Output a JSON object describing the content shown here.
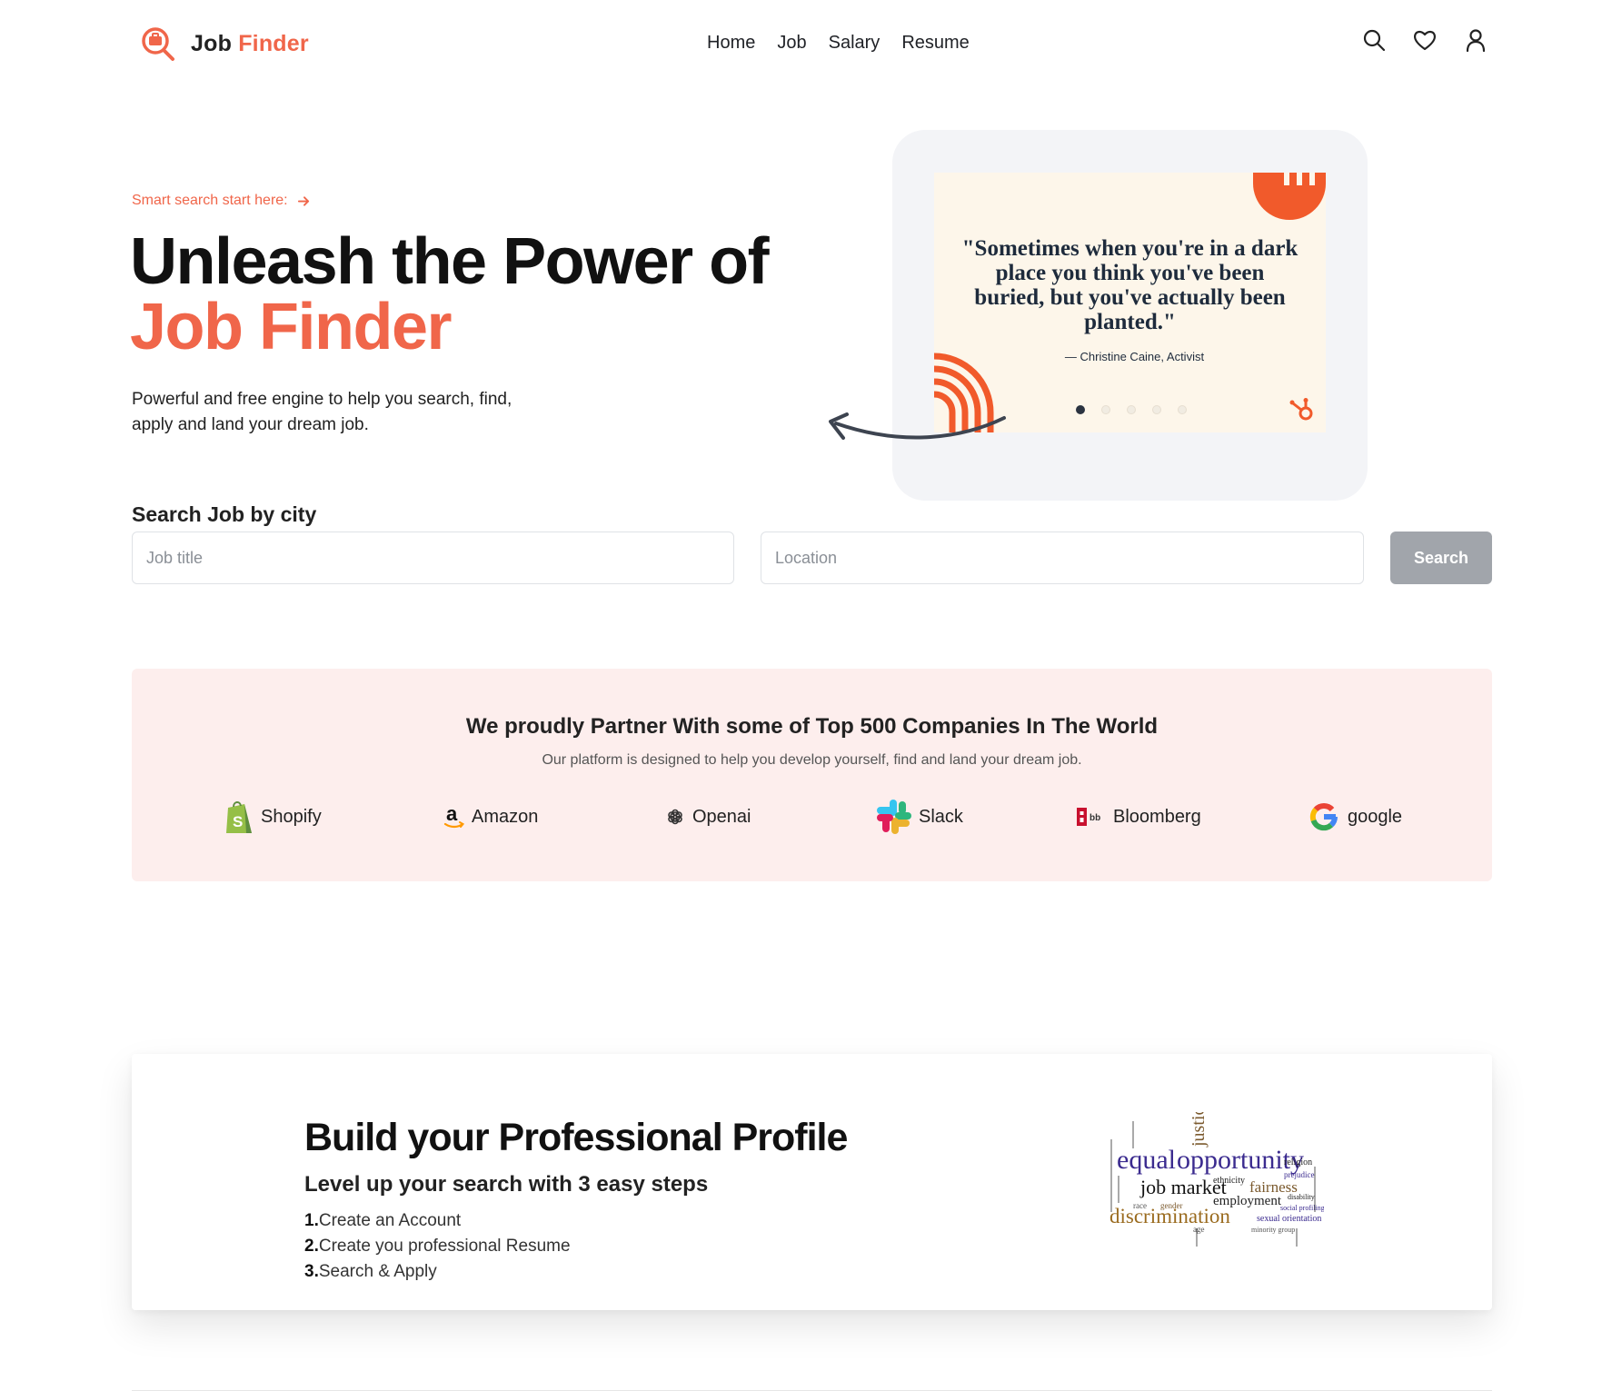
{
  "brand": {
    "name_part1": "Job",
    "name_part2": "Finder"
  },
  "nav": {
    "items": [
      "Home",
      "Job",
      "Salary",
      "Resume"
    ]
  },
  "hero": {
    "eyebrow": "Smart search start here:",
    "title_line1": "Unleash the Power of",
    "title_line2": "Job Finder",
    "description": "Powerful and free engine to help you search, find, apply and land your dream job."
  },
  "quote": {
    "text": "\"Sometimes when you're in a dark place you think you've been buried, but you've actually been planted.\"",
    "author": "— Christine Caine, Activist",
    "slides": 5,
    "active_slide": 0
  },
  "search": {
    "label": "Search Job by city",
    "job_placeholder": "Job title",
    "location_placeholder": "Location",
    "button_label": "Search"
  },
  "partners": {
    "title": "We proudly Partner With some of Top 500 Companies In The World",
    "subtitle": "Our platform is designed to help you develop yourself, find and land your dream job.",
    "companies": [
      "Shopify",
      "Amazon",
      "Openai",
      "Slack",
      "Bloomberg",
      "google"
    ]
  },
  "profile": {
    "title": "Build your Professional Profile",
    "subtitle": "Level up your search with 3 easy steps",
    "steps": [
      {
        "num": "1.",
        "text": "Create an Account"
      },
      {
        "num": "2.",
        "text": "Create you professional Resume"
      },
      {
        "num": "3.",
        "text": "Search & Apply"
      }
    ],
    "wordcloud": {
      "words": [
        "equal",
        "opportunity",
        "job market",
        "discrimination",
        "employment",
        "fairness",
        "justice",
        "religion",
        "ethnicity",
        "prejudice",
        "sexual orientation",
        "disability",
        "social profiling",
        "minority group",
        "race",
        "gender",
        "age"
      ]
    }
  },
  "colors": {
    "accent": "#f0664a",
    "partner_bg": "#fdeeed",
    "button_gray": "#a1a5ab"
  }
}
